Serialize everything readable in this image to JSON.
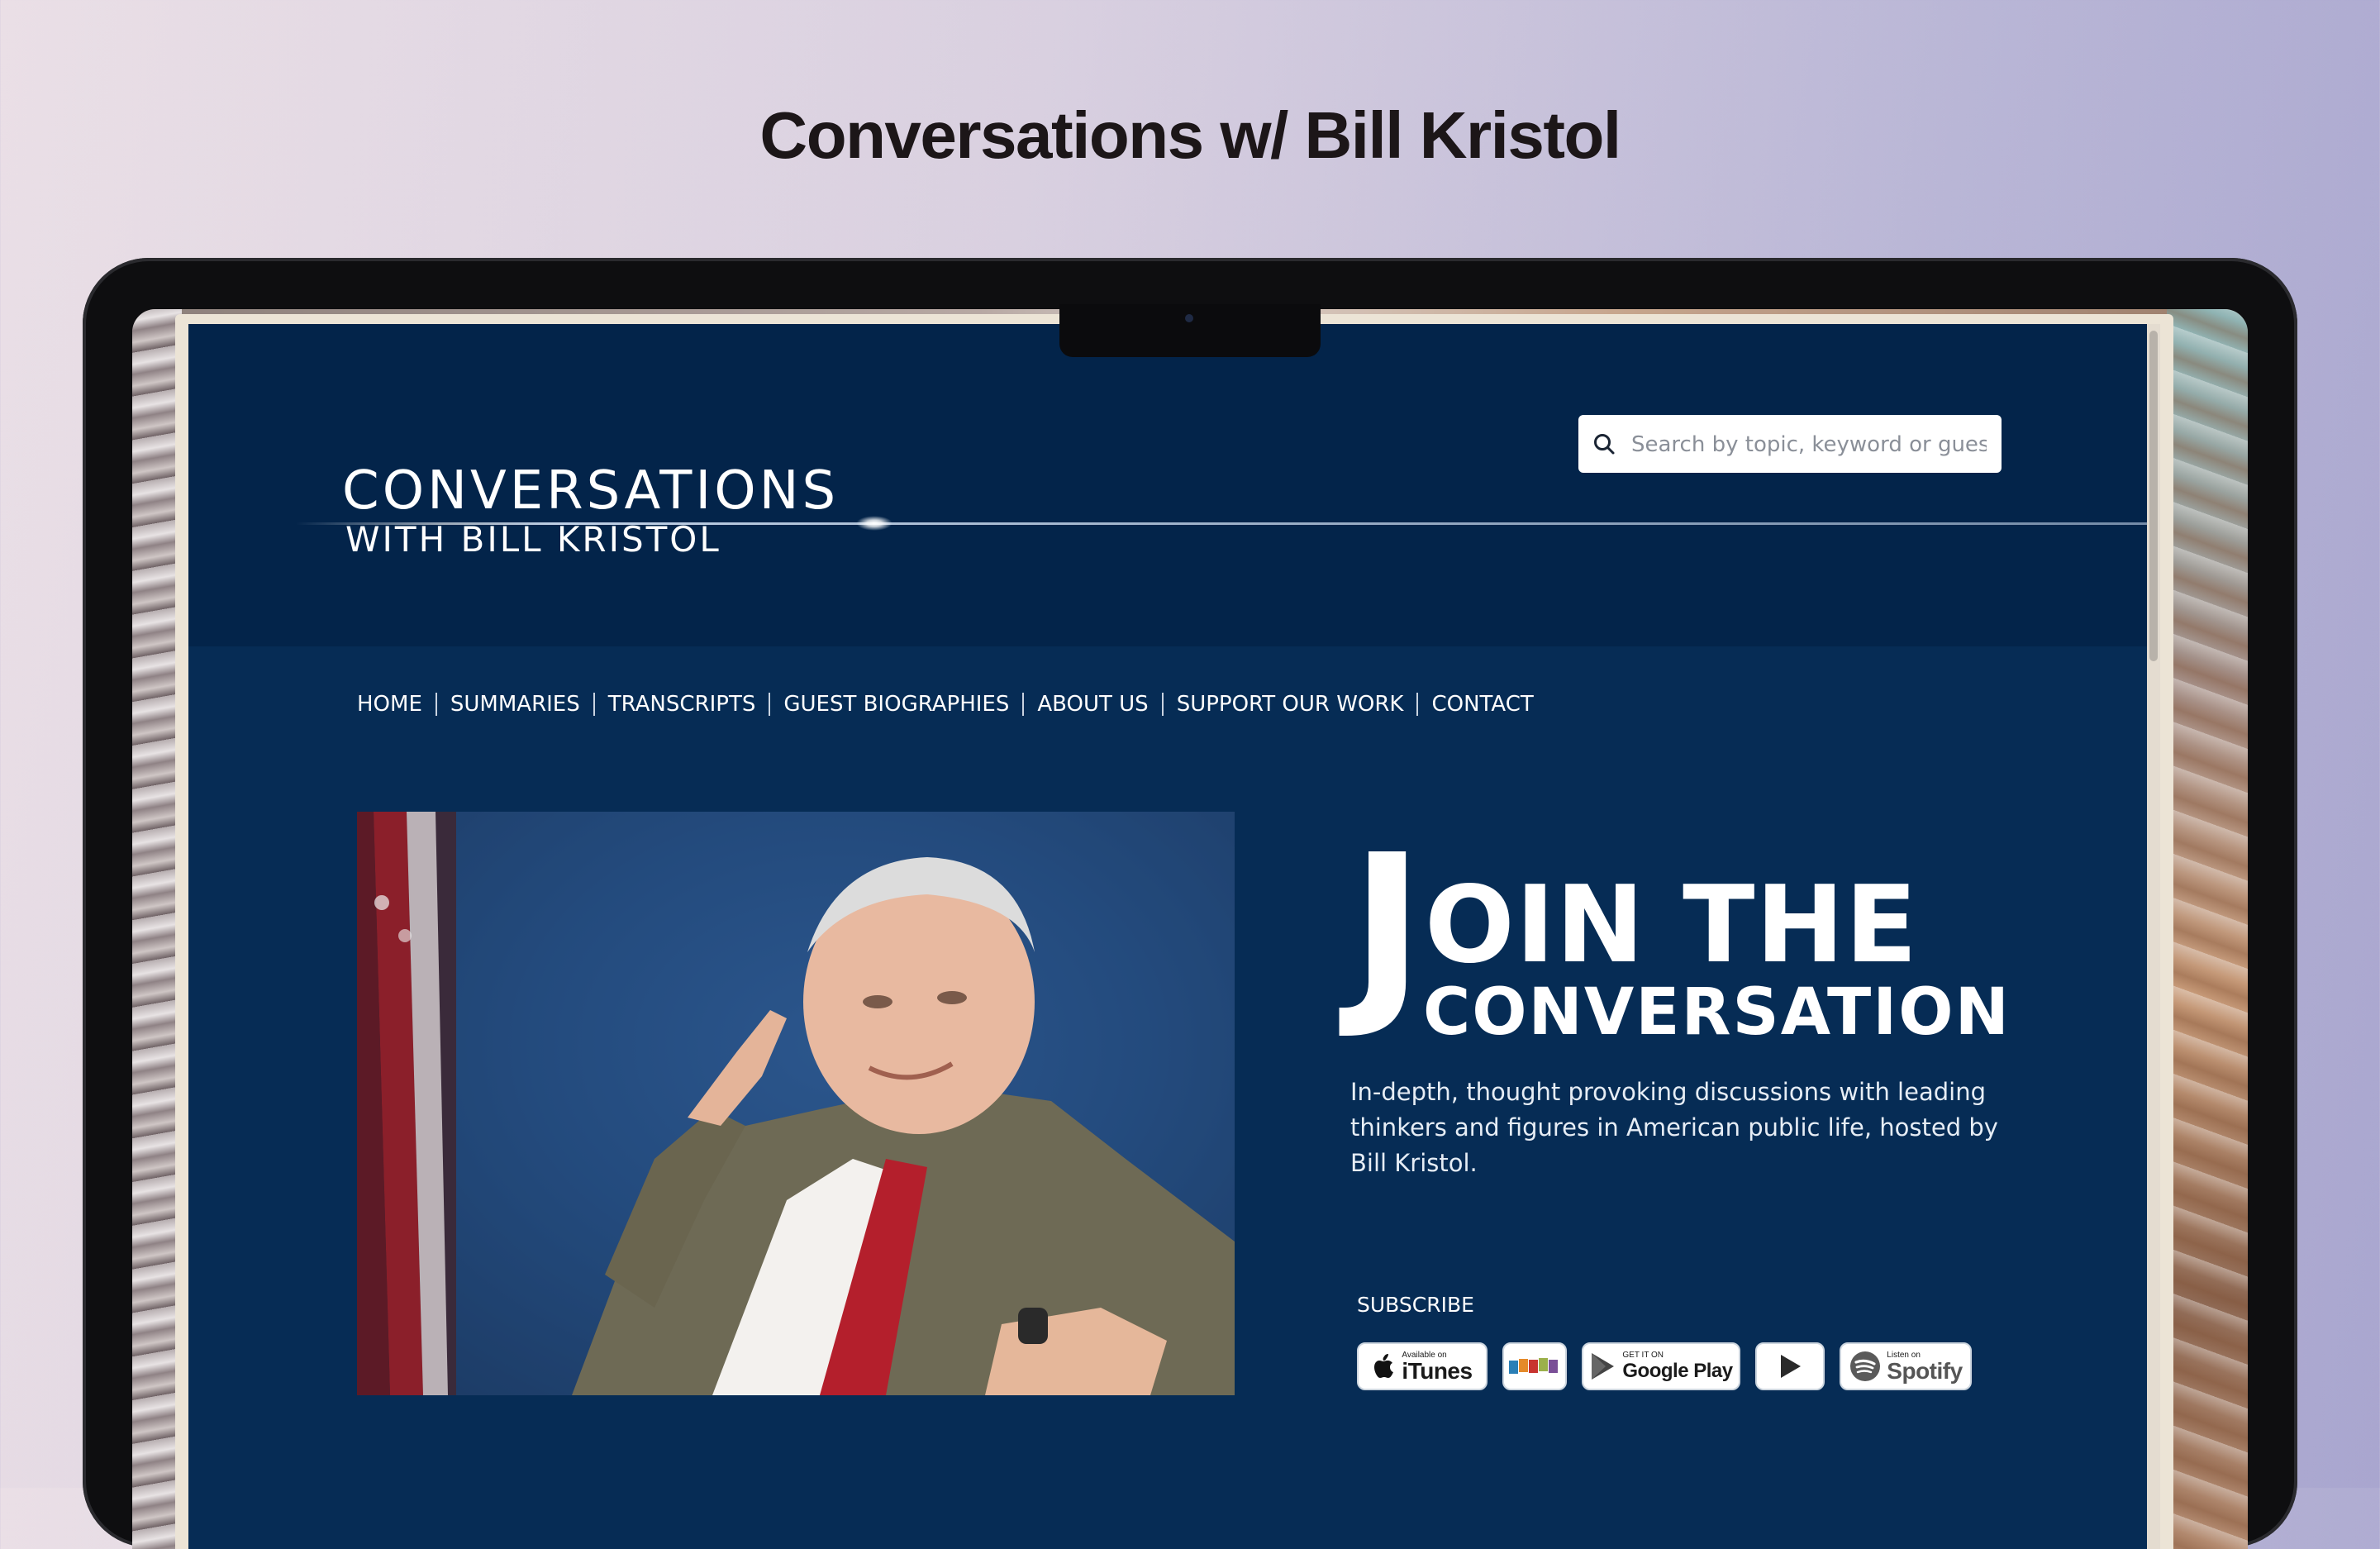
{
  "page": {
    "heading": "Conversations w/ Bill Kristol"
  },
  "site": {
    "logo": {
      "line1": "CONVERSATIONS",
      "line2": "WITH BILL KRISTOL"
    },
    "search": {
      "placeholder": "Search by topic, keyword or guest",
      "icon": "search-icon"
    },
    "nav": [
      {
        "label": "HOME"
      },
      {
        "label": "SUMMARIES"
      },
      {
        "label": "TRANSCRIPTS"
      },
      {
        "label": "GUEST BIOGRAPHIES"
      },
      {
        "label": "ABOUT US"
      },
      {
        "label": "SUPPORT OUR WORK"
      },
      {
        "label": "CONTACT"
      }
    ],
    "hero": {
      "headline_first_letter": "J",
      "headline_rest": "OIN THE",
      "headline_line2": "CONVERSATION",
      "tagline": "In-depth, thought provoking discussions with leading thinkers and figures in American public life, hosted by Bill Kristol."
    },
    "subscribe": {
      "label": "SUBSCRIBE",
      "badges": [
        {
          "name": "itunes",
          "small": "Available on",
          "big": "iTunes",
          "icon": "apple-icon"
        },
        {
          "name": "stitcher",
          "icon": "stitcher-icon"
        },
        {
          "name": "google-play",
          "small": "GET IT ON",
          "big": "Google Play",
          "icon": "google-play-icon"
        },
        {
          "name": "youtube",
          "icon": "play-icon"
        },
        {
          "name": "spotify",
          "small": "Listen on",
          "big": "Spotify",
          "icon": "spotify-icon"
        }
      ]
    }
  },
  "colors": {
    "site_background": "#062c55",
    "header_background": "#03244a",
    "text": "#ffffff"
  }
}
